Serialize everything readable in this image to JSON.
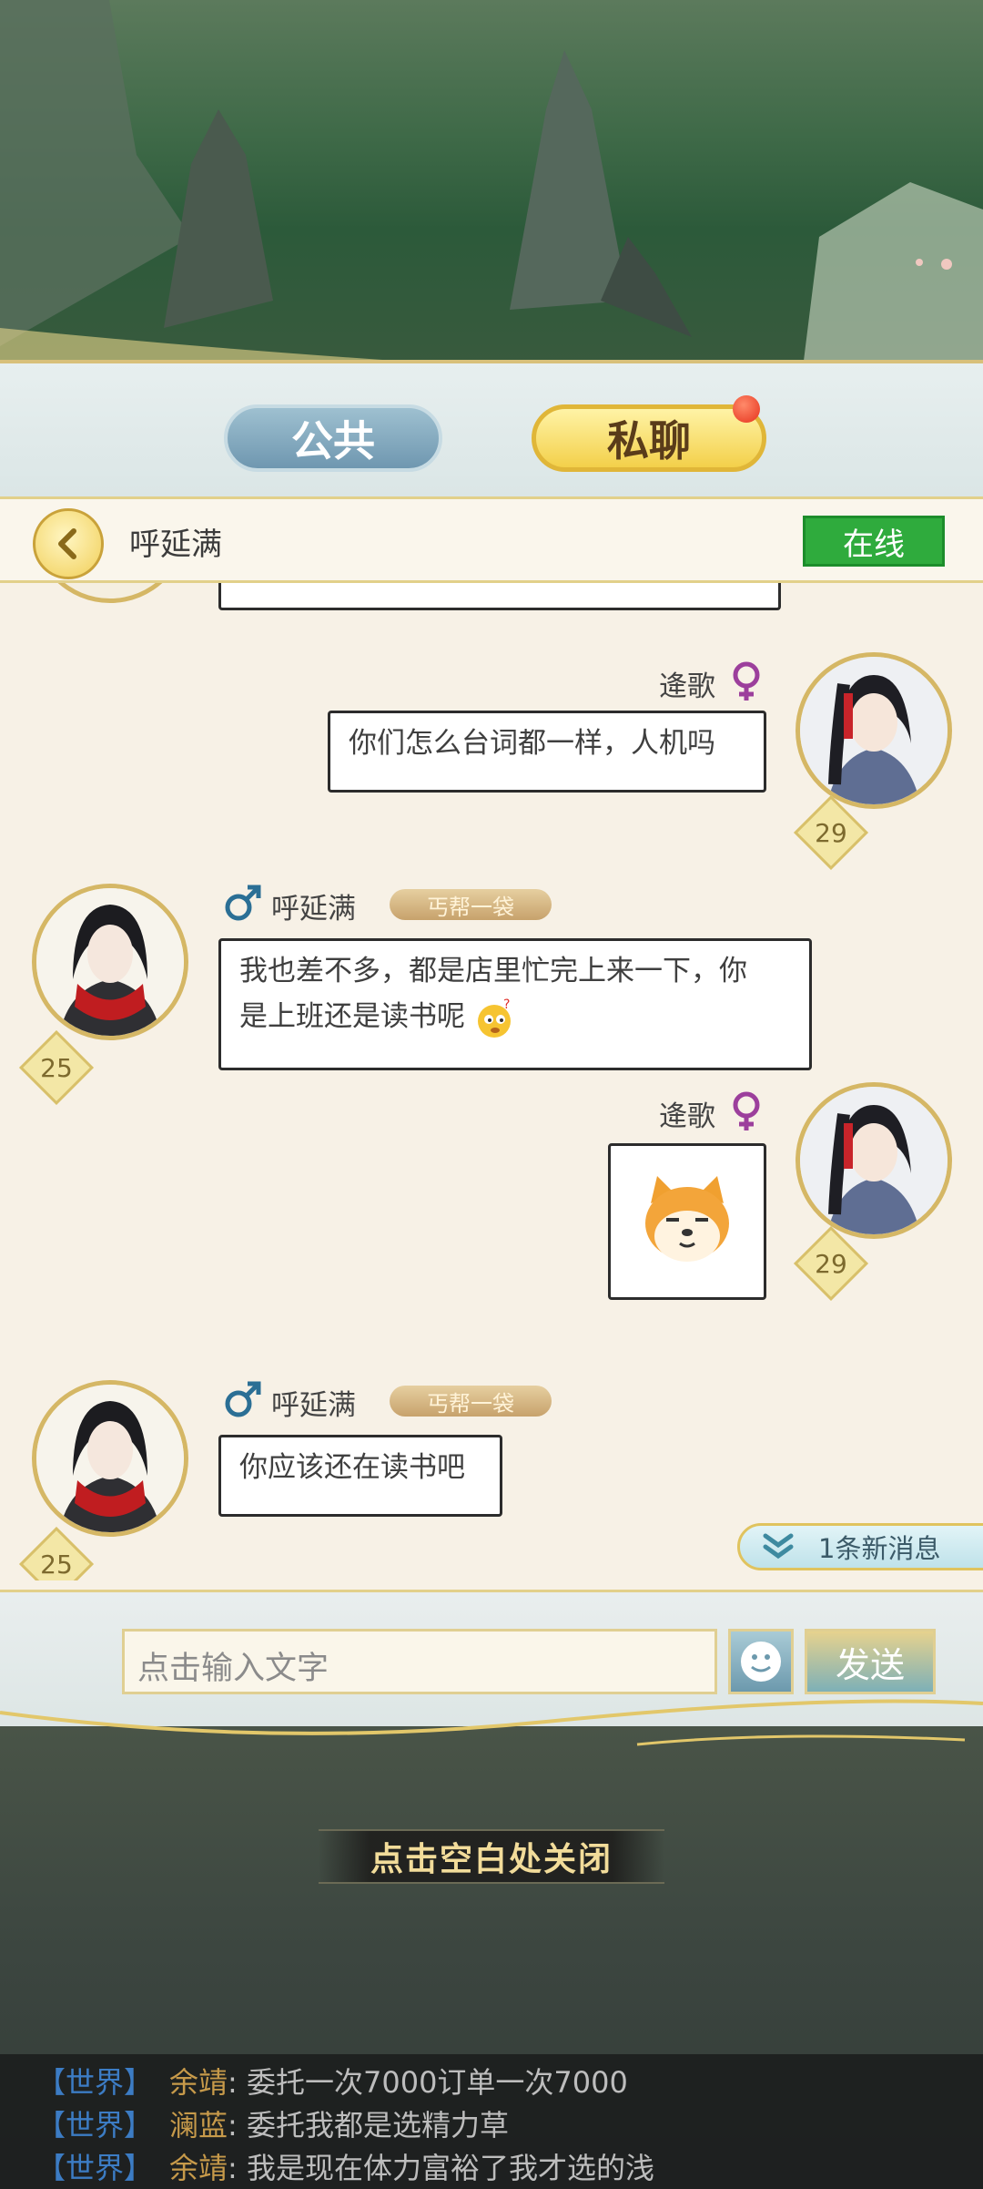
{
  "tabs": {
    "public": "公共",
    "private": "私聊"
  },
  "conversation": {
    "name": "呼延满",
    "status": "在线"
  },
  "messages": [
    {
      "side": "right",
      "sender": "逄歌",
      "gender": "female",
      "level": "29",
      "text": "你们怎么台词都一样，人机吗"
    },
    {
      "side": "left",
      "sender": "呼延满",
      "gender": "male",
      "level": "25",
      "guild": "丐帮一袋",
      "text_line1": "我也差不多，都是店里忙完上来一下，你",
      "text_line2": "是上班还是读书呢"
    },
    {
      "side": "right",
      "sender": "逄歌",
      "gender": "female",
      "level": "29",
      "sticker": "shiba-dog-sticker"
    },
    {
      "side": "left",
      "sender": "呼延满",
      "gender": "male",
      "level": "25",
      "guild": "丐帮一袋",
      "text": "你应该还在读书吧"
    }
  ],
  "new_messages": "1条新消息",
  "input": {
    "placeholder": "点击输入文字",
    "send": "发送"
  },
  "close_hint": "点击空白处关闭",
  "world_chat": [
    {
      "tag": "【世界】",
      "name": "余靖",
      "text": "委托一次7000订单一次7000"
    },
    {
      "tag": "【世界】",
      "name": "澜蓝",
      "text": "委托我都是选精力草"
    },
    {
      "tag": "【世界】",
      "name": "余靖",
      "text": "我是现在体力富裕了我才选的浅"
    }
  ],
  "colors": {
    "online": "#2fab3d",
    "female": "#9c3f9c",
    "male": "#2b6f95",
    "world_tag": "#3c7cc4"
  }
}
